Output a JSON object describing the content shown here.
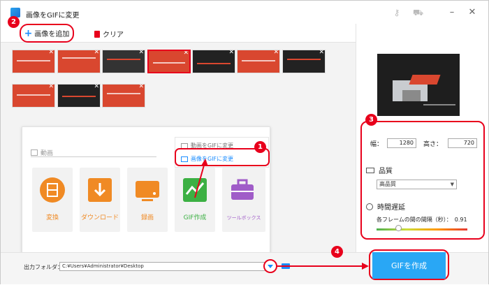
{
  "app": {
    "title": "画像をGIFに変更"
  },
  "toolbar": {
    "add_label": "画像を追加",
    "clear_label": "クリア"
  },
  "popup": {
    "section_label": "動画",
    "menu_items": [
      "動画をGIFに変更",
      "画像をGIFに変更"
    ],
    "tiles": [
      {
        "label": "変換",
        "color": "#f08a24"
      },
      {
        "label": "ダウンロード",
        "color": "#f08a24"
      },
      {
        "label": "録画",
        "color": "#f08a24"
      },
      {
        "label": "GIF作成",
        "color": "#3cb043"
      },
      {
        "label": "ツールボックス",
        "color": "#a05cc8"
      }
    ]
  },
  "settings": {
    "width_label": "幅：",
    "width_value": "1280",
    "height_label": "高さ：",
    "height_value": "720",
    "quality_label": "品質",
    "quality_value": "高品質",
    "delay_label": "時間遅延",
    "interval_label": "各フレームの間の間隔（秒）：",
    "interval_value": "0.91"
  },
  "bottom": {
    "output_label": "出力フォルダ：",
    "output_path": "C:¥Users¥Administrator¥Desktop",
    "create_label": "GIFを作成"
  },
  "badges": [
    "1",
    "2",
    "3",
    "4"
  ],
  "colors": {
    "accent": "#29a7f5",
    "annotation": "#e8001c"
  }
}
